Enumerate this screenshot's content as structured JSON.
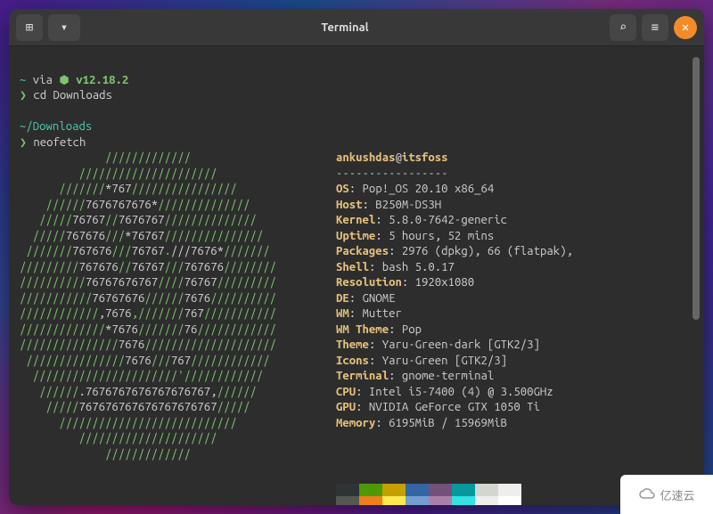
{
  "header": {
    "title": "Terminal"
  },
  "icons": {
    "new_tab": "⊞",
    "dropdown": "▾",
    "search": "⌕",
    "menu": "≡",
    "close": "✕",
    "node": "⬢"
  },
  "prompt1": {
    "path": "~",
    "via": " via ",
    "node_ver": "v12.18.2",
    "marker": "❯",
    "command": "cd Downloads"
  },
  "prompt2": {
    "path": "~/Downloads",
    "marker": "❯",
    "command": "neofetch"
  },
  "neofetch": {
    "user": "ankushdas",
    "at": "@",
    "host": "itsfoss",
    "sep": "-----------------",
    "info": [
      {
        "k": "OS",
        "v": ": Pop!_OS 20.10 x86_64"
      },
      {
        "k": "Host",
        "v": ": B250M-DS3H"
      },
      {
        "k": "Kernel",
        "v": ": 5.8.0-7642-generic"
      },
      {
        "k": "Uptime",
        "v": ": 5 hours, 52 mins"
      },
      {
        "k": "Packages",
        "v": ": 2976 (dpkg), 66 (flatpak),"
      },
      {
        "k": "Shell",
        "v": ": bash 5.0.17"
      },
      {
        "k": "Resolution",
        "v": ": 1920x1080"
      },
      {
        "k": "DE",
        "v": ": GNOME"
      },
      {
        "k": "WM",
        "v": ": Mutter"
      },
      {
        "k": "WM Theme",
        "v": ": Pop"
      },
      {
        "k": "Theme",
        "v": ": Yaru-Green-dark [GTK2/3]"
      },
      {
        "k": "Icons",
        "v": ": Yaru-Green [GTK2/3]"
      },
      {
        "k": "Terminal",
        "v": ": gnome-terminal"
      },
      {
        "k": "CPU",
        "v": ": Intel i5-7400 (4) @ 3.500GHz"
      },
      {
        "k": "GPU",
        "v": ": NVIDIA GeForce GTX 1050 Ti"
      },
      {
        "k": "Memory",
        "v": ": 6195MiB / 15969MiB"
      }
    ],
    "palette_top": [
      "#2e3436",
      "#4e9a06",
      "#c4a000",
      "#3465a4",
      "#75507b",
      "#06989a",
      "#d3d7cf",
      "#eeeeec"
    ],
    "palette_bottom": [
      "#555753",
      "#ef7f1a",
      "#fce94f",
      "#729fcf",
      "#ad7fa8",
      "#34e2e2",
      "#eeeeec",
      "#ffffff"
    ]
  },
  "logo_lines": [
    [
      [
        "g",
        "             /////////////             "
      ]
    ],
    [
      [
        "g",
        "         /////////////////////         "
      ]
    ],
    [
      [
        "g",
        "      ///////"
      ],
      [
        "w",
        "*767"
      ],
      [
        "g",
        "////////////////      "
      ]
    ],
    [
      [
        "g",
        "    //////"
      ],
      [
        "w",
        "7676767676*"
      ],
      [
        "g",
        "//////////////    "
      ]
    ],
    [
      [
        "g",
        "   /////"
      ],
      [
        "w",
        "76767"
      ],
      [
        "g",
        "//"
      ],
      [
        "w",
        "7676767"
      ],
      [
        "g",
        "//////////////   "
      ]
    ],
    [
      [
        "g",
        "  /////"
      ],
      [
        "w",
        "767676"
      ],
      [
        "g",
        "///"
      ],
      [
        "w",
        "*76767"
      ],
      [
        "g",
        "///////////////  "
      ]
    ],
    [
      [
        "g",
        " ///////"
      ],
      [
        "w",
        "767676"
      ],
      [
        "g",
        "///"
      ],
      [
        "w",
        "76767"
      ],
      [
        "g",
        "."
      ],
      [
        "w",
        "///"
      ],
      [
        "w",
        "7676*"
      ],
      [
        "g",
        "/////// "
      ]
    ],
    [
      [
        "g",
        "/////////"
      ],
      [
        "w",
        "767676"
      ],
      [
        "g",
        "//"
      ],
      [
        "w",
        "76767"
      ],
      [
        "g",
        "///"
      ],
      [
        "w",
        "767676"
      ],
      [
        "g",
        "////////"
      ]
    ],
    [
      [
        "g",
        "//////////"
      ],
      [
        "w",
        "76767676767"
      ],
      [
        "g",
        "////"
      ],
      [
        "w",
        "76767"
      ],
      [
        "g",
        "/////////"
      ]
    ],
    [
      [
        "g",
        "///////////"
      ],
      [
        "w",
        "76767676"
      ],
      [
        "g",
        "//////"
      ],
      [
        "w",
        "7676"
      ],
      [
        "g",
        "//////////"
      ]
    ],
    [
      [
        "g",
        "////////////"
      ],
      [
        "w",
        ",7676"
      ],
      [
        "g",
        ",///////"
      ],
      [
        "w",
        "767"
      ],
      [
        "g",
        "///////////"
      ]
    ],
    [
      [
        "g",
        "/////////////"
      ],
      [
        "w",
        "*7676"
      ],
      [
        "g",
        "///////"
      ],
      [
        "w",
        "76"
      ],
      [
        "g",
        "////////////"
      ]
    ],
    [
      [
        "g",
        "///////////////"
      ],
      [
        "w",
        "7676"
      ],
      [
        "g",
        "////////////////////"
      ]
    ],
    [
      [
        "g",
        " ///////////////"
      ],
      [
        "w",
        "7676"
      ],
      [
        "g",
        "///"
      ],
      [
        "w",
        "767"
      ],
      [
        "g",
        "//////////// "
      ]
    ],
    [
      [
        "g",
        "  //////////////////////"
      ],
      [
        "g",
        "'"
      ],
      [
        "g",
        "////////////  "
      ]
    ],
    [
      [
        "g",
        "   //////"
      ],
      [
        "w",
        ".7676767676767676767,"
      ],
      [
        "g",
        "//////   "
      ]
    ],
    [
      [
        "g",
        "    /////"
      ],
      [
        "w",
        "767676767676767676767"
      ],
      [
        "g",
        "/////    "
      ]
    ],
    [
      [
        "g",
        "      ///////////////////////////      "
      ]
    ],
    [
      [
        "g",
        "         /////////////////////         "
      ]
    ],
    [
      [
        "g",
        "             /////////////             "
      ]
    ]
  ],
  "watermark": "亿速云"
}
